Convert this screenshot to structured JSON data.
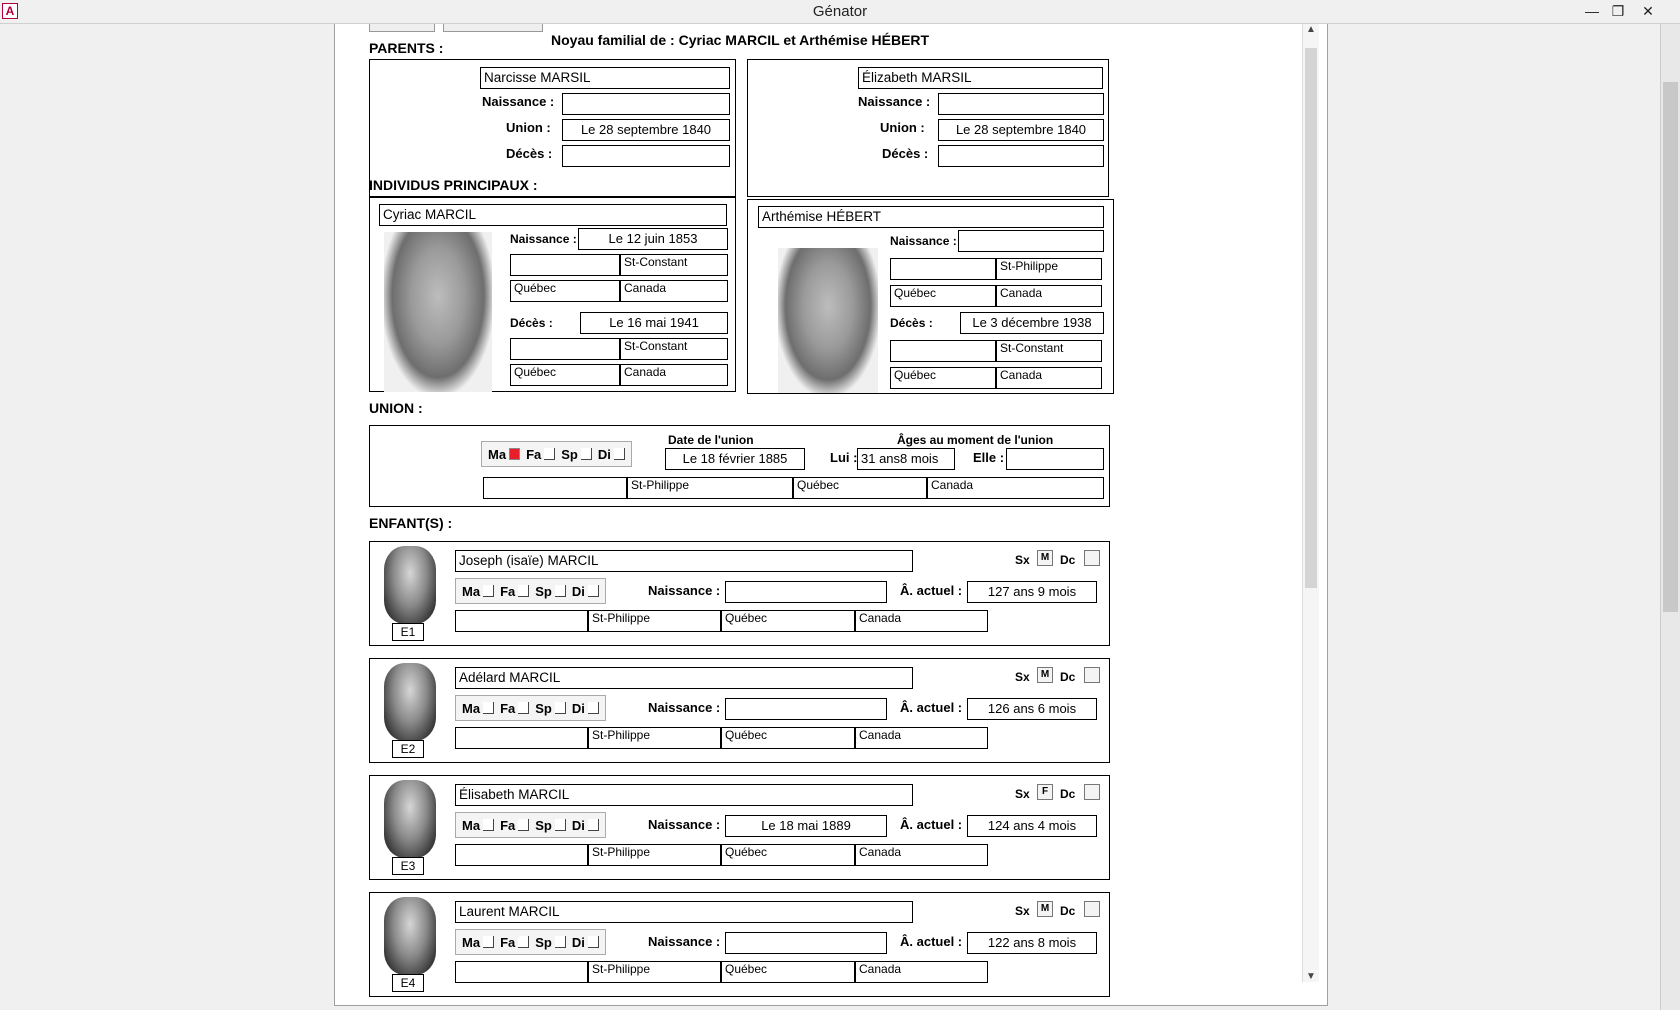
{
  "window": {
    "title": "Génator",
    "app_icon": "A"
  },
  "form": {
    "title": "Noyau familial de : Cyriac MARCIL et Arthémise HÉBERT",
    "sections": {
      "parents": "PARENTS :",
      "principals": "INDIVIDUS PRINCIPAUX :",
      "union": "UNION :",
      "children": "ENFANT(S) :"
    },
    "labels": {
      "birth": "Naissance :",
      "union": "Union :",
      "death": "Décès :",
      "union_date": "Date de l'union",
      "ages": "Âges au moment de l'union",
      "him": "Lui :",
      "her": "Elle :",
      "current_age": "Â. actuel :",
      "sex": "Sx",
      "deceased": "Dc",
      "ma": "Ma",
      "fa": "Fa",
      "sp": "Sp",
      "di": "Di"
    },
    "parents": [
      {
        "name": "Narcisse MARSIL",
        "birth": "",
        "union": "Le 28 septembre 1840",
        "death": ""
      },
      {
        "name": "Élizabeth MARSIL",
        "birth": "",
        "union": "Le 28 septembre 1840",
        "death": ""
      }
    ],
    "principals": [
      {
        "name": "Cyriac MARCIL",
        "birth_date": "Le 12 juin 1853",
        "birth_place": [
          "",
          "St-Constant",
          "Québec",
          "Canada"
        ],
        "death_date": "Le 16 mai 1941",
        "death_place": [
          "",
          "St-Constant",
          "Québec",
          "Canada"
        ]
      },
      {
        "name": "Arthémise HÉBERT",
        "birth_date": "",
        "birth_place": [
          "",
          "St-Philippe",
          "Québec",
          "Canada"
        ],
        "death_date": "Le 3 décembre 1938",
        "death_place": [
          "",
          "St-Constant",
          "Québec",
          "Canada"
        ]
      }
    ],
    "union": {
      "date": "Le 18 février 1885",
      "age_him": "31 ans8 mois",
      "age_her": "",
      "place": [
        "",
        "St-Philippe",
        "Québec",
        "Canada"
      ],
      "ma_checked": true
    },
    "children": [
      {
        "name": "Joseph (isaïe) MARCIL",
        "sex": "M",
        "birth": "",
        "current_age": "127 ans 9 mois",
        "place": [
          "",
          "St-Philippe",
          "Québec",
          "Canada"
        ],
        "tag": "E1"
      },
      {
        "name": "Adélard MARCIL",
        "sex": "M",
        "birth": "",
        "current_age": "126 ans 6 mois",
        "place": [
          "",
          "St-Philippe",
          "Québec",
          "Canada"
        ],
        "tag": "E2"
      },
      {
        "name": "Élisabeth MARCIL",
        "sex": "F",
        "birth": "Le 18 mai 1889",
        "current_age": "124 ans 4 mois",
        "place": [
          "",
          "St-Philippe",
          "Québec",
          "Canada"
        ],
        "tag": "E3"
      },
      {
        "name": "Laurent MARCIL",
        "sex": "M",
        "birth": "",
        "current_age": "122 ans 8 mois",
        "place": [
          "",
          "St-Philippe",
          "Québec",
          "Canada"
        ],
        "tag": "E4"
      }
    ]
  }
}
